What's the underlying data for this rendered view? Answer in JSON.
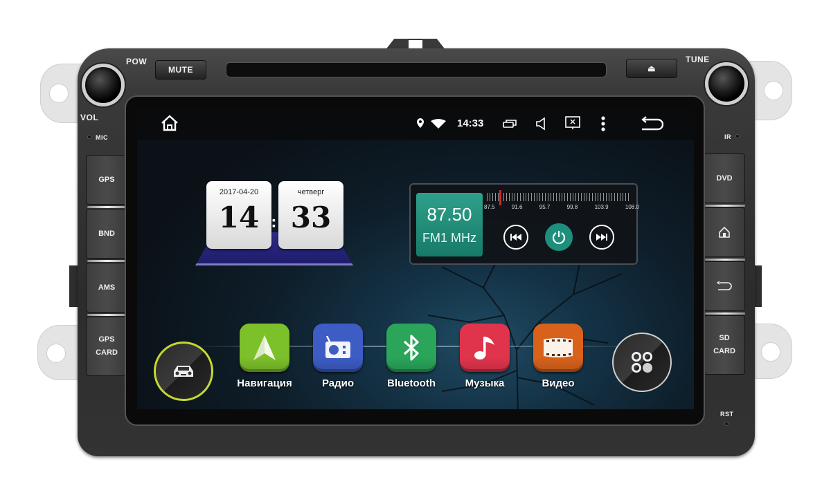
{
  "device": {
    "bezel_labels": {
      "pow": "POW",
      "vol": "VOL",
      "mic": "MIC",
      "tune": "TUNE",
      "ir": "IR",
      "rst": "RST"
    },
    "top_buttons": {
      "mute": "MUTE",
      "eject_icon": "⏏"
    },
    "left_buttons": [
      {
        "line1": "GPS",
        "line2": ""
      },
      {
        "line1": "BND",
        "line2": ""
      },
      {
        "line1": "AMS",
        "line2": ""
      },
      {
        "line1": "GPS",
        "line2": "CARD"
      }
    ],
    "right_buttons": [
      {
        "line1": "DVD",
        "line2": "",
        "icon": ""
      },
      {
        "line1": "",
        "line2": "",
        "icon": "home-icon"
      },
      {
        "line1": "",
        "line2": "",
        "icon": "back-icon"
      },
      {
        "line1": "SD",
        "line2": "CARD",
        "icon": ""
      }
    ]
  },
  "statusbar": {
    "time": "14:33",
    "icons": [
      "home-icon",
      "location-icon",
      "wifi-icon",
      "recent-apps-icon",
      "volume-icon",
      "screen-off-icon",
      "more-icon",
      "back-icon"
    ]
  },
  "clock_widget": {
    "date": "2017-04-20",
    "weekday": "четверг",
    "hours": "14",
    "minutes": "33"
  },
  "radio_widget": {
    "frequency": "87.50",
    "band_unit": "FM1 MHz",
    "scale_labels": [
      "87.5",
      "91.6",
      "95.7",
      "99.8",
      "103.9",
      "108.0"
    ],
    "scale_min": 87.5,
    "scale_max": 108.0,
    "current_value": 87.5,
    "accent_color": "#1d8f7c"
  },
  "apps": [
    {
      "label": "Навигация",
      "icon": "navigation-icon",
      "color": "#7cc02a"
    },
    {
      "label": "Радио",
      "icon": "radio-icon",
      "color": "#3d5cc4"
    },
    {
      "label": "Bluetooth",
      "icon": "bluetooth-icon",
      "color": "#2aa55a"
    },
    {
      "label": "Музыка",
      "icon": "music-icon",
      "color": "#e0344c"
    },
    {
      "label": "Видео",
      "icon": "video-icon",
      "color": "#d8621c"
    }
  ],
  "dock": {
    "car_button_ring_color": "#c8d832",
    "all_apps_icon": "all-apps-icon"
  }
}
